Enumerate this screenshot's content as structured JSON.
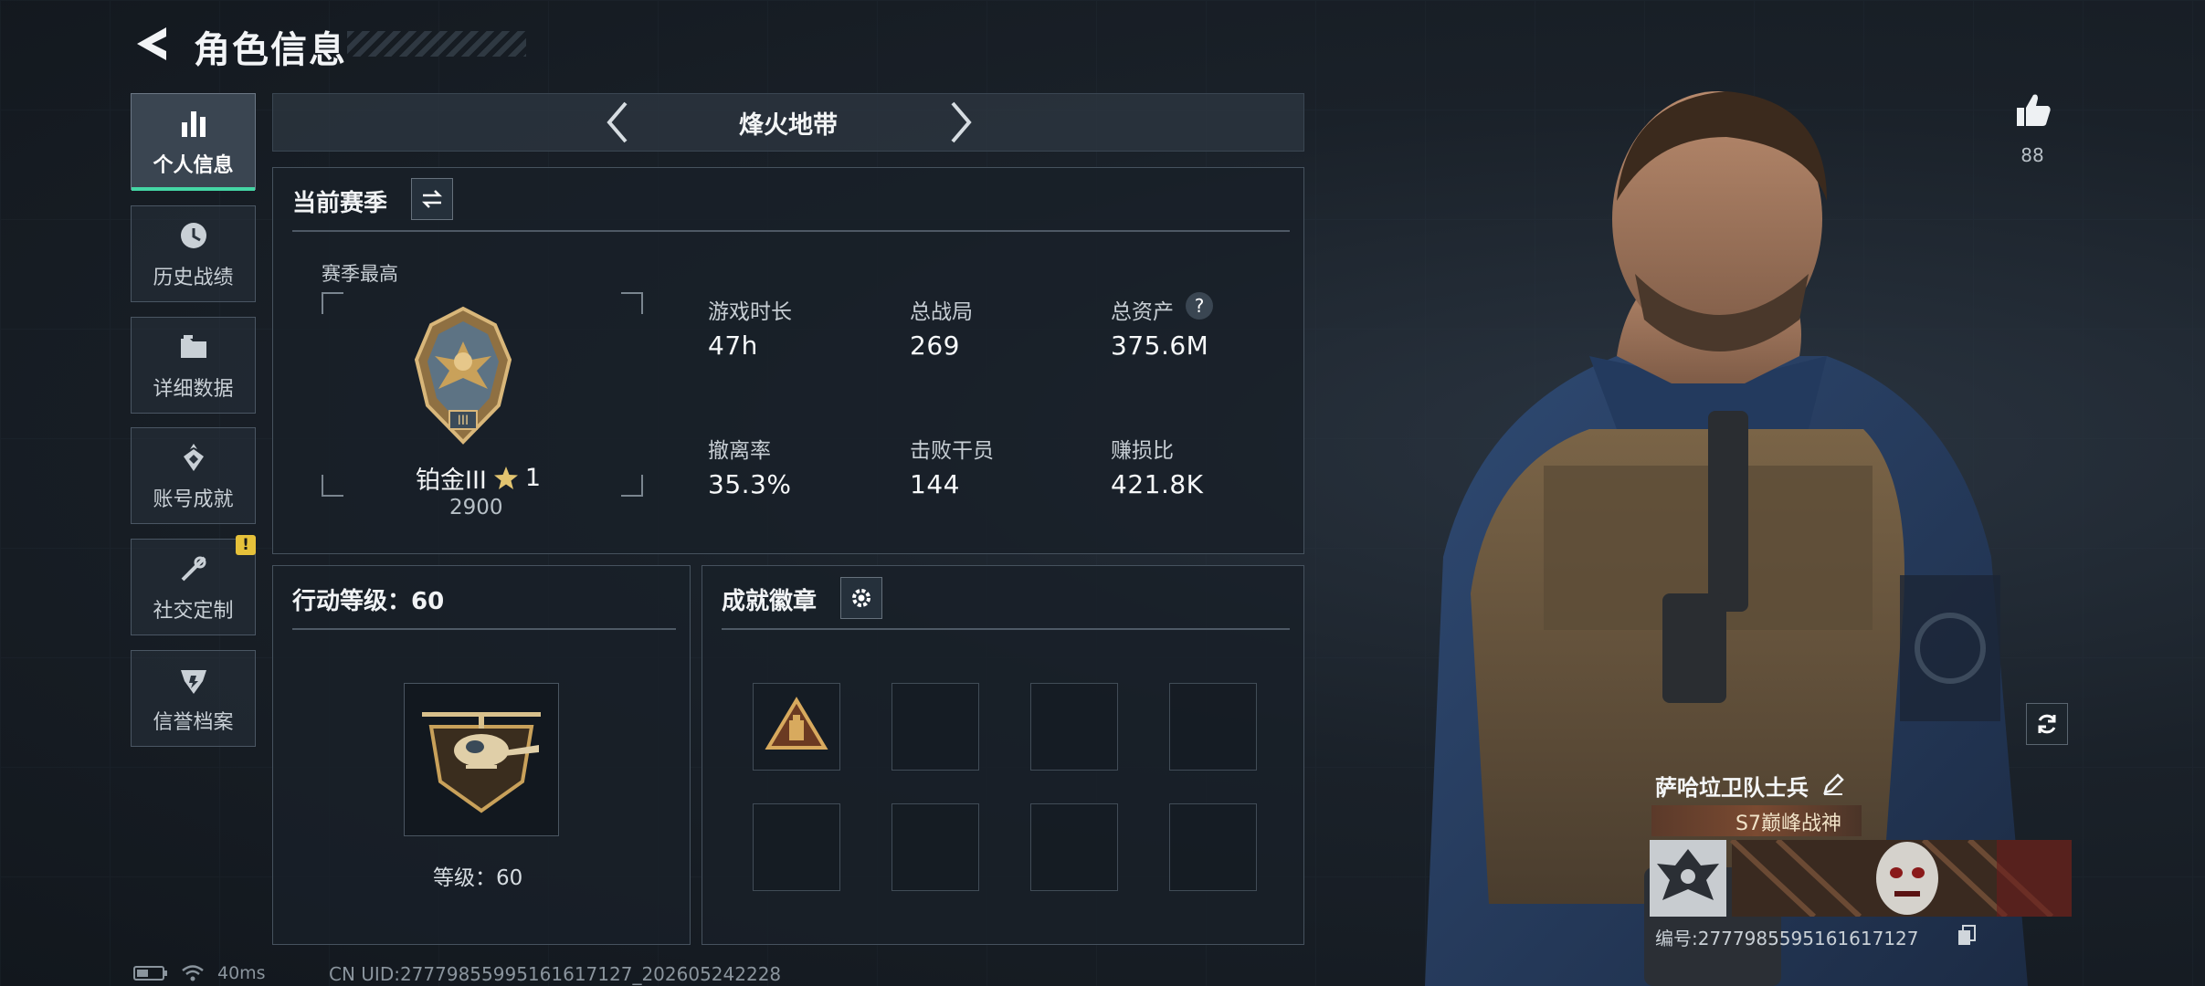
{
  "header": {
    "title": "角色信息"
  },
  "sidebar": {
    "items": [
      {
        "label": "个人信息",
        "icon": "bar-chart-icon",
        "active": true
      },
      {
        "label": "历史战绩",
        "icon": "clock-icon",
        "active": false
      },
      {
        "label": "详细数据",
        "icon": "folder-icon",
        "active": false
      },
      {
        "label": "账号成就",
        "icon": "medal-icon",
        "active": false
      },
      {
        "label": "社交定制",
        "icon": "tools-icon",
        "active": false,
        "badge": "!"
      },
      {
        "label": "信誉档案",
        "icon": "shield-icon",
        "active": false
      }
    ]
  },
  "mode": {
    "label": "烽火地带"
  },
  "season": {
    "title": "当前赛季",
    "best_label": "赛季最高",
    "rank_name": "铂金III",
    "rank_stars": "1",
    "rank_score": "2900",
    "stats": [
      {
        "label": "游戏时长",
        "value": "47h"
      },
      {
        "label": "总战局",
        "value": "269"
      },
      {
        "label": "总资产",
        "value": "375.6M",
        "help": "?"
      },
      {
        "label": "撤离率",
        "value": "35.3%"
      },
      {
        "label": "击败干员",
        "value": "144"
      },
      {
        "label": "赚损比",
        "value": "421.8K"
      }
    ]
  },
  "action_level": {
    "title": "行动等级：60",
    "level_text": "等级：60"
  },
  "achievements": {
    "title": "成就徽章"
  },
  "profile": {
    "likes": "88",
    "character_name": "萨哈垃卫队士兵",
    "title_plate": "S7巅峰战神",
    "uid_line": "编号:277798559516161712​7"
  },
  "status_bar": {
    "ping": "40ms",
    "uid": "CN UID:2777985599516161712​7_202605242228"
  },
  "colors": {
    "accent": "#44d6a5",
    "warning": "#e6c13a",
    "gold": "#c9a15a"
  }
}
